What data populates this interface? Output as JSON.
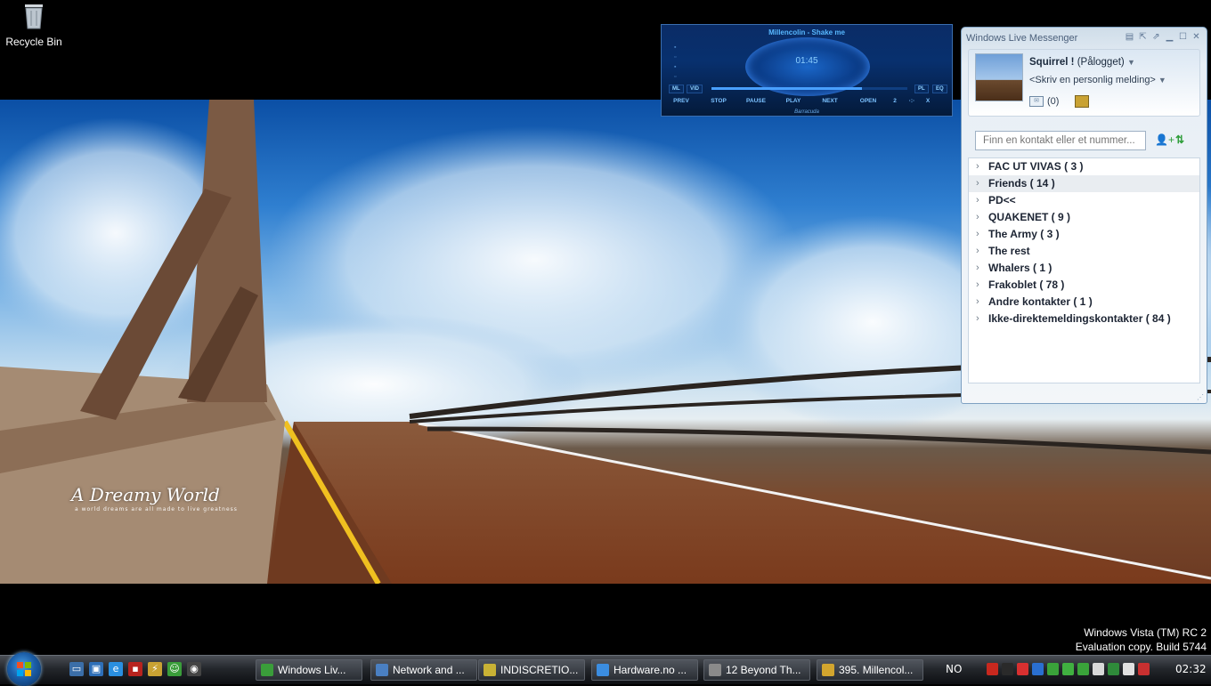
{
  "desktop": {
    "recycle_bin_label": "Recycle Bin",
    "wallpaper_title": "A Dreamy World",
    "wallpaper_subtitle": "a world dreams are all made to live greatness"
  },
  "player": {
    "track_title": "Millencolin - Shake me",
    "time": "01:45",
    "progress_fraction": 0.77,
    "buttons": {
      "ml": "ML",
      "vid": "VID",
      "pl": "PL",
      "eq": "EQ",
      "prev": "PREV",
      "stop": "STOP",
      "pause": "PAUSE",
      "play": "PLAY",
      "next": "NEXT",
      "open": "OPEN",
      "counter": "2",
      "close": "X"
    },
    "brand": "Barracuda"
  },
  "messenger": {
    "window_title": "Windows Live Messenger",
    "user_name": "Squirrel !",
    "user_status": "(Pålogget)",
    "personal_message": "<Skriv en personlig melding>",
    "mail_count": "(0)",
    "search_placeholder": "Finn en kontakt eller et nummer...",
    "groups": [
      {
        "label": "FAC UT VIVAS ( 3 )"
      },
      {
        "label": "Friends ( 14 )"
      },
      {
        "label": "PD<<"
      },
      {
        "label": "QUAKENET ( 9 )"
      },
      {
        "label": "The Army ( 3 )"
      },
      {
        "label": "The rest"
      },
      {
        "label": "Whalers ( 1 )"
      },
      {
        "label": "Frakoblet ( 78 )"
      },
      {
        "label": "Andre kontakter ( 1 )"
      },
      {
        "label": "Ikke-direktemeldingskontakter ( 84 )"
      }
    ]
  },
  "build_info": {
    "line1": "Windows Vista (TM) RC 2",
    "line2": "Evaluation copy. Build 5744"
  },
  "taskbar": {
    "buttons": [
      {
        "label": "Windows Liv...",
        "icon": "messenger-icon",
        "color": "#3a9d3a"
      },
      {
        "label": "Network and ...",
        "icon": "network-icon",
        "color": "#4a7fc1"
      },
      {
        "label": "INDISCRETIO...",
        "icon": "notepad-icon",
        "color": "#c9b235"
      },
      {
        "label": "Hardware.no ...",
        "icon": "ie-icon",
        "color": "#3b8de0"
      },
      {
        "label": "12 Beyond Th...",
        "icon": "media-icon",
        "color": "#8a8a8a"
      },
      {
        "label": "395. Millencol...",
        "icon": "winamp-icon",
        "color": "#d2a52e"
      }
    ],
    "language": "NO",
    "clock": "02:32",
    "tray_colors": [
      "#c8281e",
      "#2a2a2a",
      "#d83030",
      "#2a6fd0",
      "#3aa33a",
      "#40b040",
      "#3aa33a",
      "#d8d8d8",
      "#2f8a3a",
      "#e0e0e0",
      "#c83030"
    ]
  }
}
